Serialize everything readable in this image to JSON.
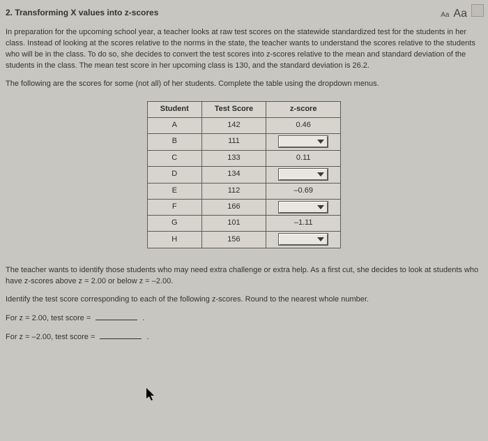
{
  "header": {
    "title": "2.  Transforming X values into z-scores",
    "font_small": "Aa",
    "font_large": "Aa"
  },
  "intro": "In preparation for the upcoming school year, a teacher looks at raw test scores on the statewide standardized test for the students in her class. Instead of looking at the scores relative to the norms in the state, the teacher wants to understand the scores relative to the students who will be in the class. To do so, she decides to convert the test scores into z-scores relative to the mean and standard deviation of the students in the class. The mean test score in her upcoming class is 130, and the standard deviation is 26.2.",
  "instr": "The following are the scores for some (not all) of her students. Complete the table using the dropdown menus.",
  "table": {
    "head": {
      "c1": "Student",
      "c2": "Test Score",
      "c3": "z-score"
    },
    "rows": [
      {
        "student": "A",
        "score": "142",
        "z": "0.46",
        "dropdown": false
      },
      {
        "student": "B",
        "score": "111",
        "z": "",
        "dropdown": true
      },
      {
        "student": "C",
        "score": "133",
        "z": "0.11",
        "dropdown": false
      },
      {
        "student": "D",
        "score": "134",
        "z": "",
        "dropdown": true
      },
      {
        "student": "E",
        "score": "112",
        "z": "–0.69",
        "dropdown": false
      },
      {
        "student": "F",
        "score": "166",
        "z": "",
        "dropdown": true
      },
      {
        "student": "G",
        "score": "101",
        "z": "–1.11",
        "dropdown": false
      },
      {
        "student": "H",
        "score": "156",
        "z": "",
        "dropdown": true
      }
    ]
  },
  "followup1": "The teacher wants to identify those students who may need extra challenge or extra help. As a first cut, she decides to look at students who have z-scores above z = 2.00 or below z = –2.00.",
  "followup2": "Identify the test score corresponding to each of the following z-scores. Round to the nearest whole number.",
  "q1": {
    "pre": "For z = 2.00, test score =",
    "post": "."
  },
  "q2": {
    "pre": "For z = –2.00, test score =",
    "post": "."
  }
}
